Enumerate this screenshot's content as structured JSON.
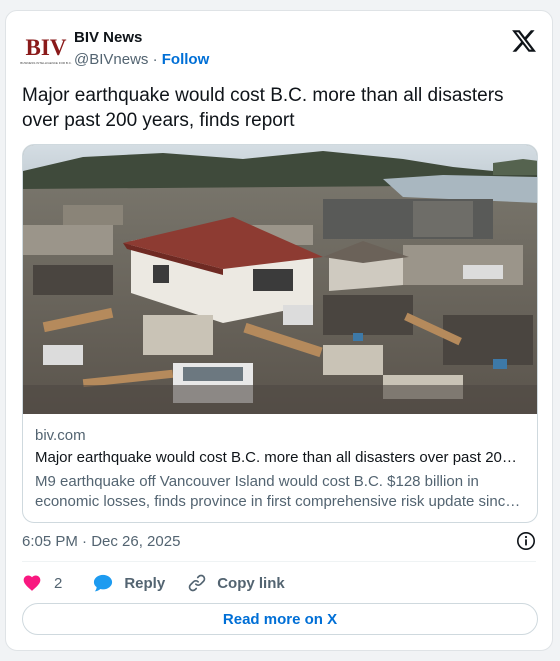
{
  "author": {
    "logo_text": "BIV",
    "logo_subtext": "BUSINESS INTELLIGENCE FOR B.C.",
    "name": "BIV News",
    "handle": "@BIVnews",
    "separator": "·",
    "follow_label": "Follow"
  },
  "tweet": {
    "text": "Major earthquake would cost B.C. more than all disasters over past 200 years, finds report"
  },
  "link_card": {
    "domain": "biv.com",
    "title": "Major earthquake would cost B.C. more than all disasters over past 20…",
    "description": "M9 earthquake off Vancouver Island would cost B.C. $128 billion in economic losses, finds province in first comprehensive risk update sinc…",
    "image_icon": "tsunami-debris-photo"
  },
  "meta": {
    "timestamp": "6:05 PM · Dec 26, 2025"
  },
  "actions": {
    "like_count": "2",
    "reply_label": "Reply",
    "copy_label": "Copy link"
  },
  "read_more_label": "Read more on X",
  "colors": {
    "accent": "#006fd6",
    "like": "#f91880",
    "reply": "#1d9bf0",
    "secondary_text": "#536471",
    "logo_red": "#8a1a1a"
  },
  "icons": {
    "brand": "x-logo-icon",
    "info": "info-icon",
    "like": "heart-icon",
    "reply": "speech-bubble-icon",
    "copy": "link-icon"
  }
}
